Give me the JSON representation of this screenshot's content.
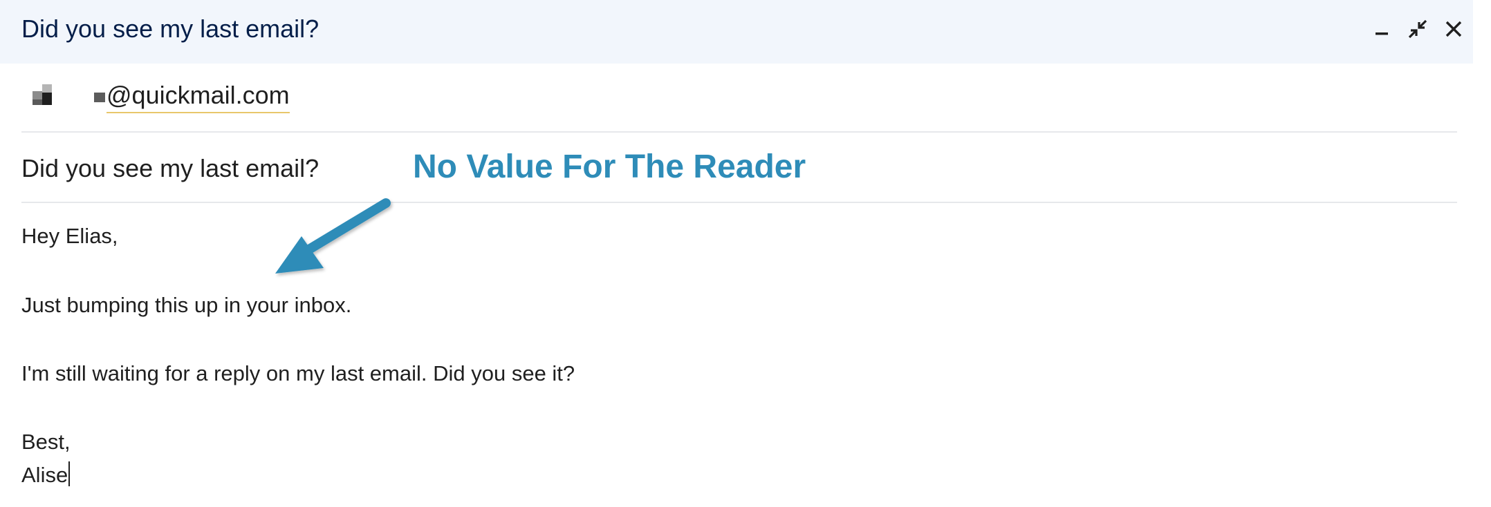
{
  "window": {
    "title": "Did you see my last email?",
    "controls": {
      "minimize_icon": "minimize-icon",
      "exit_fullscreen_icon": "exit-fullscreen-icon",
      "close_icon": "close-icon"
    }
  },
  "recipient": {
    "email": "@quickmail.com"
  },
  "subject": "Did you see my last email?",
  "body": {
    "greeting": "Hey Elias,",
    "line1": "Just bumping this up in your inbox.",
    "line2": "I'm still waiting for a reply on my last email. Did you see it?",
    "signoff": "Best,",
    "signature": "Alise"
  },
  "annotation": {
    "text": "No Value For The Reader",
    "color": "#2e8cb8"
  },
  "colors": {
    "header_bg": "#f2f6fc",
    "header_text": "#041e49",
    "annotation": "#2e8cb8"
  }
}
